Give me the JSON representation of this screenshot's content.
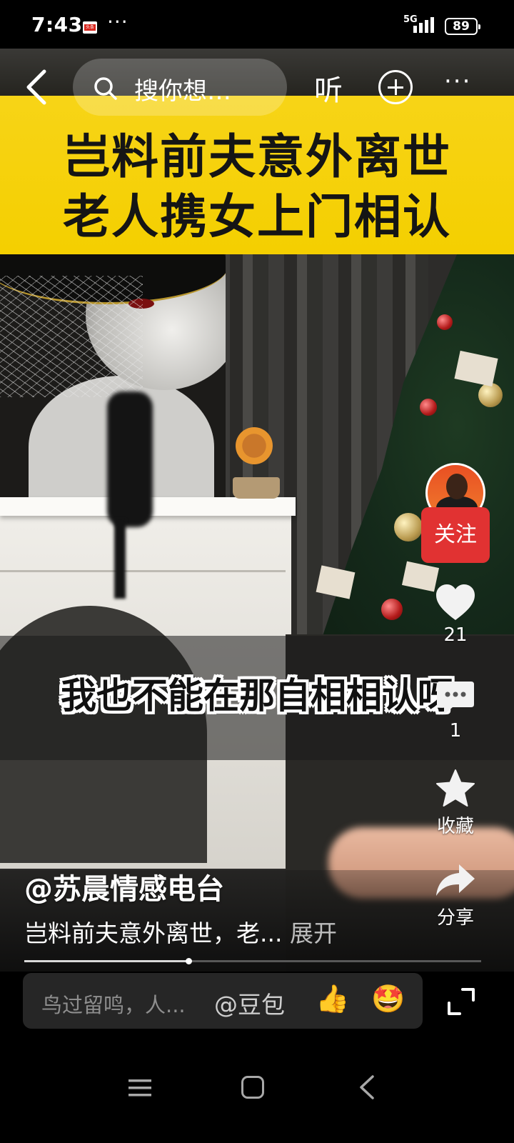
{
  "status_bar": {
    "time": "7:43",
    "app_icon_label": "头条",
    "more_dots": "···",
    "network": "5G",
    "battery": "89"
  },
  "top_nav": {
    "search_placeholder": "搜你想…",
    "listen_label": "听"
  },
  "headline": {
    "line1": "岂料前夫意外离世",
    "line2": "老人携女上门相认"
  },
  "subtitle": "我也不能在那自相相认呀",
  "right_rail": {
    "follow_label": "关注",
    "likes": "21",
    "comments": "1",
    "favorite_label": "收藏",
    "share_label": "分享"
  },
  "video_info": {
    "author": "@苏晨情感电台",
    "caption": "岂料前夫意外离世，老...",
    "expand_label": "展开",
    "progress": 0.36
  },
  "comment_bar": {
    "placeholder": "鸟过留鸣，人...",
    "mention": "@豆包",
    "emoji_thumb": "👍",
    "emoji_star": "🤩"
  },
  "colors": {
    "banner_yellow": "#f4cf00",
    "follow_red": "#e13232"
  }
}
